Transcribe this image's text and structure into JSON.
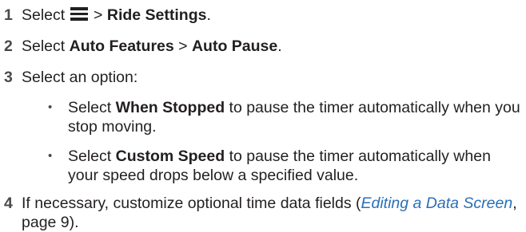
{
  "steps": [
    {
      "number": "1",
      "select": "Select",
      "icon": "menu-icon",
      "sep": ">",
      "target": "Ride Settings",
      "end": "."
    },
    {
      "number": "2",
      "select": "Select",
      "item1": "Auto Features",
      "sep": ">",
      "item2": "Auto Pause",
      "end": "."
    },
    {
      "number": "3",
      "text": "Select an option:",
      "bullets": [
        {
          "prefix": "Select",
          "bold": "When Stopped",
          "rest": "to pause the timer automatically when you stop moving."
        },
        {
          "prefix": "Select",
          "bold": "Custom Speed",
          "rest": "to pause the timer automatically when your speed drops below a specified value."
        }
      ]
    },
    {
      "number": "4",
      "text_before": "If necessary, customize optional time data fields (",
      "link": "Editing a Data Screen",
      "text_after": ", page 9)."
    }
  ],
  "colors": {
    "text": "#231f20",
    "step_number": "#4a4a4a",
    "link": "#2a6fb7"
  },
  "bullet_glyph": "•"
}
